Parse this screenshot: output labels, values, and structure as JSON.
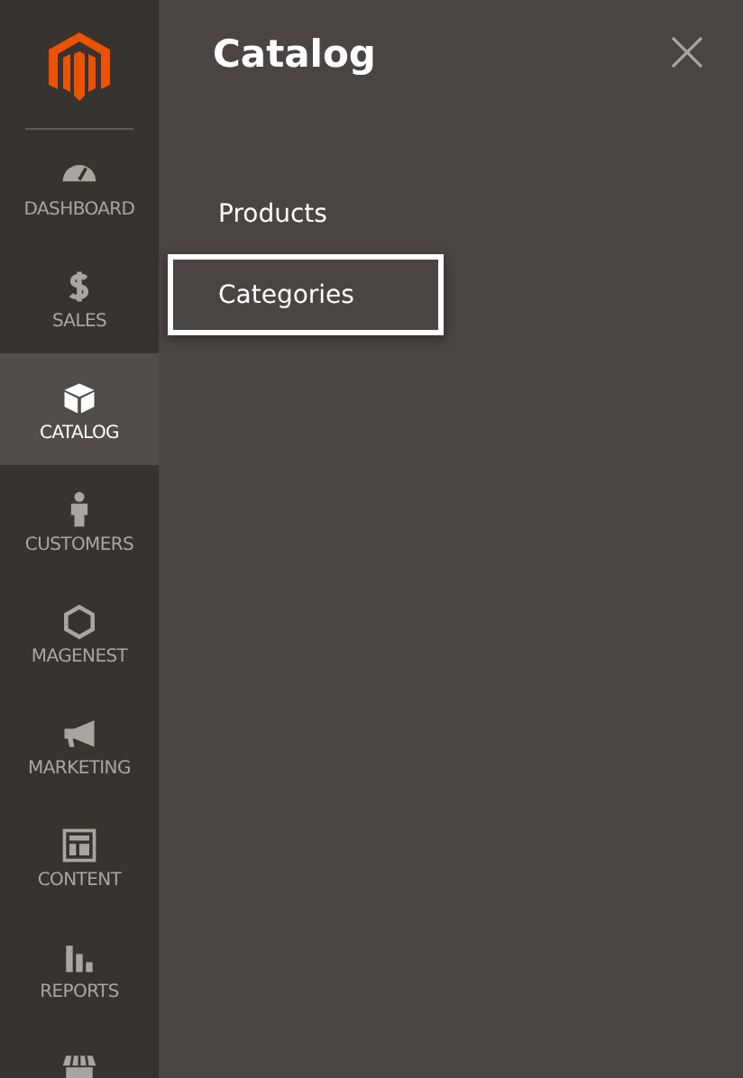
{
  "sidebar": {
    "items": [
      {
        "label": "DASHBOARD",
        "selected": false
      },
      {
        "label": "SALES",
        "selected": false
      },
      {
        "label": "CATALOG",
        "selected": true
      },
      {
        "label": "CUSTOMERS",
        "selected": false
      },
      {
        "label": "MAGENEST",
        "selected": false
      },
      {
        "label": "MARKETING",
        "selected": false
      },
      {
        "label": "CONTENT",
        "selected": false
      },
      {
        "label": "REPORTS",
        "selected": false
      },
      {
        "selected": false
      }
    ]
  },
  "panel": {
    "title": "Catalog",
    "items": [
      {
        "label": "Products",
        "highlighted": false
      },
      {
        "label": "Categories",
        "highlighted": true
      }
    ]
  }
}
